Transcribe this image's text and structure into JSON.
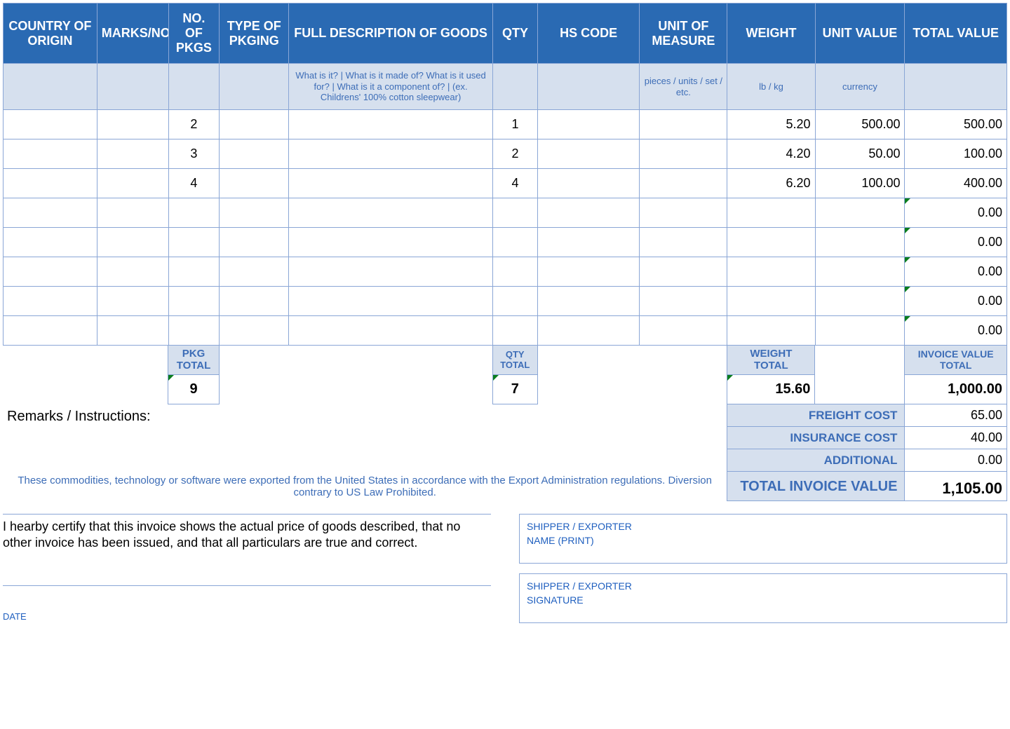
{
  "headers": {
    "country": "COUNTRY OF ORIGIN",
    "marks": "MARKS/NO's",
    "pkgs": "NO. OF PKGS",
    "pkging": "TYPE OF PKGING",
    "desc": "FULL DESCRIPTION OF GOODS",
    "qty": "QTY",
    "hs": "HS CODE",
    "uom": "UNIT OF MEASURE",
    "weight": "WEIGHT",
    "uvalue": "UNIT VALUE",
    "tvalue": "TOTAL VALUE"
  },
  "hints": {
    "desc": "What is it? | What is it made of? What is it used for? | What is it a component of? | (ex. Childrens' 100% cotton sleepwear)",
    "uom": "pieces / units / set / etc.",
    "weight": "lb / kg",
    "uvalue": "currency"
  },
  "rows": [
    {
      "pkgs": "2",
      "qty": "1",
      "weight": "5.20",
      "uvalue": "500.00",
      "tvalue": "500.00"
    },
    {
      "pkgs": "3",
      "qty": "2",
      "weight": "4.20",
      "uvalue": "50.00",
      "tvalue": "100.00"
    },
    {
      "pkgs": "4",
      "qty": "4",
      "weight": "6.20",
      "uvalue": "100.00",
      "tvalue": "400.00"
    },
    {
      "tvalue": "0.00",
      "tri": true
    },
    {
      "tvalue": "0.00",
      "tri": true
    },
    {
      "tvalue": "0.00",
      "tri": true
    },
    {
      "tvalue": "0.00",
      "tri": true
    },
    {
      "tvalue": "0.00",
      "tri": true
    }
  ],
  "subheaders": {
    "pkg": "PKG TOTAL",
    "qty": "QTY TOTAL",
    "weight": "WEIGHT TOTAL",
    "invval": "INVOICE VALUE TOTAL"
  },
  "totals": {
    "pkg": "9",
    "qty": "7",
    "weight": "15.60",
    "invval": "1,000.00"
  },
  "remarks_label": "Remarks / Instructions:",
  "costs": {
    "freight_label": "FREIGHT COST",
    "freight_val": "65.00",
    "insurance_label": "INSURANCE COST",
    "insurance_val": "40.00",
    "additional_label": "ADDITIONAL",
    "additional_val": "0.00",
    "total_label": "TOTAL INVOICE VALUE",
    "total_val": "1,105.00"
  },
  "export_note": "These commodities, technology or software were exported from the United States in accordance with the Export Administration regulations.  Diversion contrary to US Law Prohibited.",
  "certify": "I hearby certify that this invoice shows the actual price of goods described, that no other invoice has been issued, and that all particulars are true and correct.",
  "date_label": "DATE",
  "shipper_name_label1": "SHIPPER / EXPORTER",
  "shipper_name_label2": "NAME (PRINT)",
  "shipper_sig_label1": "SHIPPER / EXPORTER",
  "shipper_sig_label2": "SIGNATURE"
}
